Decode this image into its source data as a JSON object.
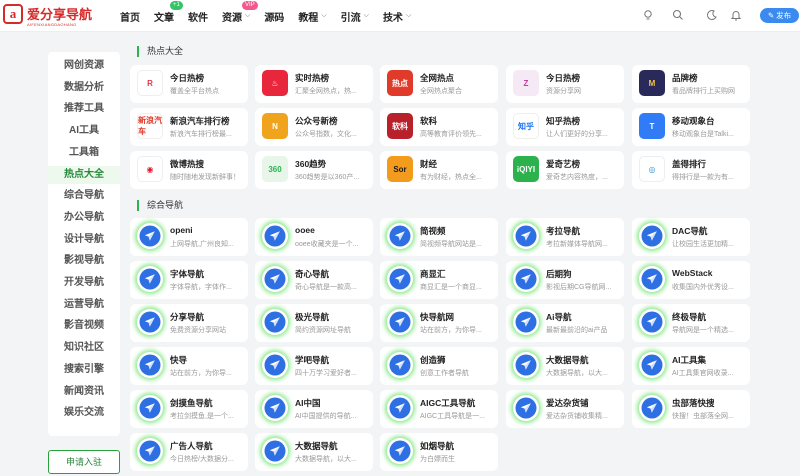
{
  "logo": {
    "mark": "a",
    "name": "爱分享导航",
    "sub": "AIFENXIANGDAOHANG"
  },
  "nav": [
    {
      "label": "首页"
    },
    {
      "label": "文章",
      "badge": "+1"
    },
    {
      "label": "软件"
    },
    {
      "label": "资源",
      "badge": "VIP",
      "caret": true
    },
    {
      "label": "源码"
    },
    {
      "label": "教程",
      "caret": true
    },
    {
      "label": "引流",
      "caret": true
    },
    {
      "label": "技术",
      "caret": true
    }
  ],
  "toolbar": {
    "publish_label": "✎ 发布",
    "icons": [
      "bulb-icon",
      "search-icon",
      "moon-icon",
      "bell-icon"
    ]
  },
  "sidebar": {
    "items": [
      "网创资源",
      "数据分析",
      "推荐工具",
      "AI工具",
      "工具箱",
      "热点大全",
      "综合导航",
      "办公导航",
      "设计导航",
      "影视导航",
      "开发导航",
      "运营导航",
      "影音视频",
      "知识社区",
      "搜索引擎",
      "新闻资讯",
      "娱乐交流"
    ],
    "active_index": 5,
    "apply_label": "申请入驻"
  },
  "sections": [
    {
      "title": "热点大全",
      "cards": [
        {
          "title": "今日热榜",
          "desc": "覆盖全平台热点",
          "icon": "jinri",
          "bg": "#ffffff",
          "fg": "#e5354a",
          "glyph": "R"
        },
        {
          "title": "实时热榜",
          "desc": "汇聚全网热点，热...",
          "icon": "shishi",
          "bg": "#e8273d",
          "fg": "#ffffff",
          "glyph": "♨"
        },
        {
          "title": "全网热点",
          "desc": "全网热点聚合",
          "icon": "quanwang",
          "bg": "#e03a2a",
          "fg": "#ffffff",
          "glyph": "热点"
        },
        {
          "title": "今日热榜",
          "desc": "资源分享网",
          "icon": "jinri2",
          "bg": "#f4e9f5",
          "fg": "#c23c9a",
          "glyph": "Z"
        },
        {
          "title": "品牌榜",
          "desc": "看品牌排行上买购网",
          "icon": "pinpai",
          "bg": "#2a2a5a",
          "fg": "#f5c542",
          "glyph": "M"
        },
        {
          "title": "新浪汽车排行榜",
          "desc": "新浪汽车排行榜最...",
          "icon": "sina",
          "bg": "#ffffff",
          "fg": "#e03a2a",
          "glyph": "新浪汽车"
        },
        {
          "title": "公众号新榜",
          "desc": "公众号指数，文化...",
          "icon": "xinbang",
          "bg": "#f0a31c",
          "fg": "#ffffff",
          "glyph": "N"
        },
        {
          "title": "软科",
          "desc": "高等教育评价领先...",
          "icon": "ruanke",
          "bg": "#b8202a",
          "fg": "#ffffff",
          "glyph": "软科"
        },
        {
          "title": "知乎热榜",
          "desc": "让人们更好的分享...",
          "icon": "zhihu",
          "bg": "#ffffff",
          "fg": "#1772f6",
          "glyph": "知乎"
        },
        {
          "title": "移动观象台",
          "desc": "移动观象台是Talki...",
          "icon": "talking",
          "bg": "#2f7cf6",
          "fg": "#ffffff",
          "glyph": "T"
        },
        {
          "title": "微博热搜",
          "desc": "随时随地发现新鲜事！",
          "icon": "weibo",
          "bg": "#ffffff",
          "fg": "#e6162d",
          "glyph": "◉"
        },
        {
          "title": "360趋势",
          "desc": "360趋势是以360产...",
          "icon": "360",
          "bg": "#e8f6ea",
          "fg": "#2db553",
          "glyph": "360"
        },
        {
          "title": "财经",
          "desc": "有为财经，热点全...",
          "icon": "caijing",
          "bg": "#f29b1d",
          "fg": "#1a1a1a",
          "glyph": "Sor"
        },
        {
          "title": "爱奇艺榜",
          "desc": "爱奇艺内容热度，...",
          "icon": "iqiyi",
          "bg": "#2bb24c",
          "fg": "#ffffff",
          "glyph": "iQIYI"
        },
        {
          "title": "盖得排行",
          "desc": "得排行是一款为有...",
          "icon": "gaide",
          "bg": "#ffffff",
          "fg": "#2e8fd8",
          "glyph": "◎"
        }
      ]
    },
    {
      "title": "综合导航",
      "cards": [
        {
          "title": "openi",
          "desc": "上网导航,广州良知..."
        },
        {
          "title": "ooee",
          "desc": "ooee收藏夹是一个..."
        },
        {
          "title": "简视频",
          "desc": "简视频导航网站是..."
        },
        {
          "title": "考拉导航",
          "desc": "考拉新媒体导航网..."
        },
        {
          "title": "DAC导航",
          "desc": "让校园生活更加精..."
        },
        {
          "title": "字体导航",
          "desc": "字体导航，字体作..."
        },
        {
          "title": "奇心导航",
          "desc": "奇心导航是一款高..."
        },
        {
          "title": "商显汇",
          "desc": "商显汇是一个商显..."
        },
        {
          "title": "后期狗",
          "desc": "影视后期CG导航网..."
        },
        {
          "title": "WebStack",
          "desc": "收集国内外优秀设..."
        },
        {
          "title": "分享导航",
          "desc": "免费资源分享网站"
        },
        {
          "title": "极光导航",
          "desc": "简约资源网址导航"
        },
        {
          "title": "快导航网",
          "desc": "站在前方，为你导..."
        },
        {
          "title": "Ai导航",
          "desc": "最新最前沿的ai产品"
        },
        {
          "title": "终极导航",
          "desc": "导航网是一个精选..."
        },
        {
          "title": "快导",
          "desc": "站在前方，为你导..."
        },
        {
          "title": "学吧导航",
          "desc": "四十万学习爱好者..."
        },
        {
          "title": "创造狮",
          "desc": "创意工作者导航"
        },
        {
          "title": "大数据导航",
          "desc": "大数据导航，以大..."
        },
        {
          "title": "AI工具集",
          "desc": "AI工具集官网收录..."
        },
        {
          "title": "剑摸鱼导航",
          "desc": "考拉剑摸鱼,是一个..."
        },
        {
          "title": "AI中国",
          "desc": "AI中国提供的导航..."
        },
        {
          "title": "AIGC工具导航",
          "desc": "AIGC工具导航是一..."
        },
        {
          "title": "爱达杂货铺",
          "desc": "爱达杂货铺收集精..."
        },
        {
          "title": "虫部落快搜",
          "desc": "快搜！虫部落全网..."
        },
        {
          "title": "广告人导航",
          "desc": "今日热榜/大数据分..."
        },
        {
          "title": "大数据导航",
          "desc": "大数据导航，以大..."
        },
        {
          "title": "如烟导航",
          "desc": "为白嫖而生"
        }
      ]
    }
  ]
}
